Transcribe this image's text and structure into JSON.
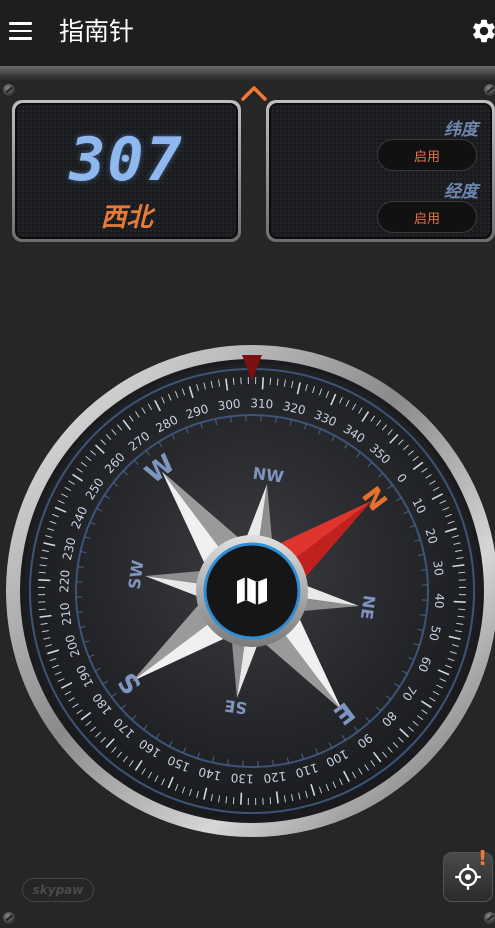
{
  "app_bar": {
    "title": "指南针",
    "menu_icon": "menu-icon",
    "settings_icon": "gear-icon"
  },
  "heading_panel": {
    "degrees": "307",
    "direction": "西北",
    "digit_color": "#8fb8ee",
    "direction_color": "#e87a3a"
  },
  "location_panel": {
    "latitude_label": "纬度",
    "latitude_button": "启用",
    "longitude_label": "经度",
    "longitude_button": "启用"
  },
  "compass": {
    "heading": 307,
    "cardinals": [
      "N",
      "E",
      "S",
      "W"
    ],
    "intercardinals": [
      "NE",
      "SE",
      "SW",
      "NW"
    ],
    "degree_labels": [
      "0",
      "10",
      "20",
      "30",
      "40",
      "50",
      "60",
      "70",
      "80",
      "90",
      "100",
      "110",
      "120",
      "130",
      "140",
      "150",
      "160",
      "170",
      "180",
      "190",
      "200",
      "210",
      "220",
      "230",
      "240",
      "250",
      "260",
      "270",
      "280",
      "290",
      "300",
      "310",
      "320",
      "330",
      "340",
      "350"
    ],
    "center_icon": "map-icon",
    "north_color": "#c0201e",
    "letter_color": "#7f95bf"
  },
  "footer": {
    "brand": "skypaw",
    "locate_icon": "crosshair-icon",
    "alert_mark": "!"
  }
}
